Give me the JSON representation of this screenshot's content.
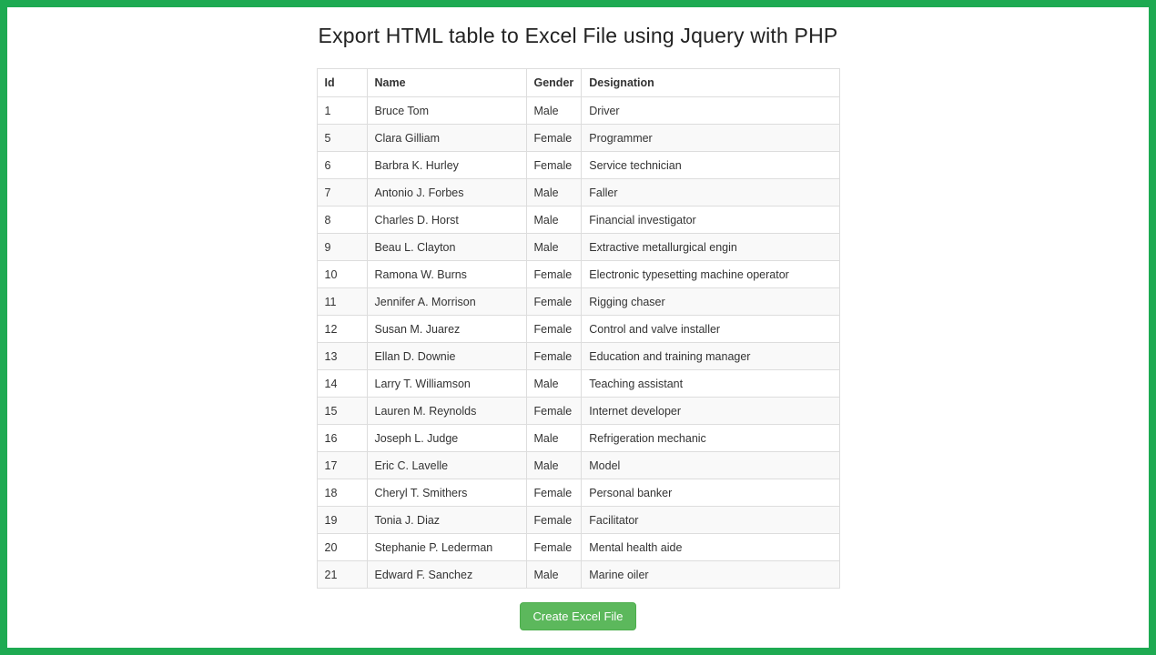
{
  "title": "Export HTML table to Excel File using Jquery with PHP",
  "columns": {
    "id": "Id",
    "name": "Name",
    "gender": "Gender",
    "designation": "Designation"
  },
  "rows": [
    {
      "id": "1",
      "name": "Bruce Tom",
      "gender": "Male",
      "designation": "Driver"
    },
    {
      "id": "5",
      "name": "Clara Gilliam",
      "gender": "Female",
      "designation": "Programmer"
    },
    {
      "id": "6",
      "name": "Barbra K. Hurley",
      "gender": "Female",
      "designation": "Service technician"
    },
    {
      "id": "7",
      "name": "Antonio J. Forbes",
      "gender": "Male",
      "designation": "Faller"
    },
    {
      "id": "8",
      "name": "Charles D. Horst",
      "gender": "Male",
      "designation": "Financial investigator"
    },
    {
      "id": "9",
      "name": "Beau L. Clayton",
      "gender": "Male",
      "designation": "Extractive metallurgical engin"
    },
    {
      "id": "10",
      "name": "Ramona W. Burns",
      "gender": "Female",
      "designation": "Electronic typesetting machine operator"
    },
    {
      "id": "11",
      "name": "Jennifer A. Morrison",
      "gender": "Female",
      "designation": "Rigging chaser"
    },
    {
      "id": "12",
      "name": "Susan M. Juarez",
      "gender": "Female",
      "designation": "Control and valve installer"
    },
    {
      "id": "13",
      "name": "Ellan D. Downie",
      "gender": "Female",
      "designation": "Education and training manager"
    },
    {
      "id": "14",
      "name": "Larry T. Williamson",
      "gender": "Male",
      "designation": "Teaching assistant"
    },
    {
      "id": "15",
      "name": "Lauren M. Reynolds",
      "gender": "Female",
      "designation": "Internet developer"
    },
    {
      "id": "16",
      "name": "Joseph L. Judge",
      "gender": "Male",
      "designation": "Refrigeration mechanic"
    },
    {
      "id": "17",
      "name": "Eric C. Lavelle",
      "gender": "Male",
      "designation": "Model"
    },
    {
      "id": "18",
      "name": "Cheryl T. Smithers",
      "gender": "Female",
      "designation": "Personal banker"
    },
    {
      "id": "19",
      "name": "Tonia J. Diaz",
      "gender": "Female",
      "designation": "Facilitator"
    },
    {
      "id": "20",
      "name": "Stephanie P. Lederman",
      "gender": "Female",
      "designation": "Mental health aide"
    },
    {
      "id": "21",
      "name": "Edward F. Sanchez",
      "gender": "Male",
      "designation": "Marine oiler"
    }
  ],
  "button": {
    "create_label": "Create Excel File"
  }
}
